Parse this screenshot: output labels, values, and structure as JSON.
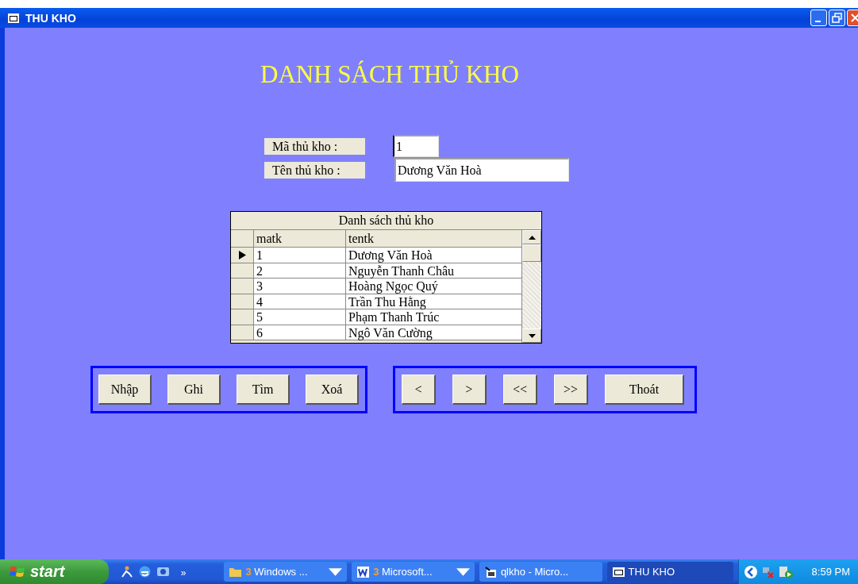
{
  "window": {
    "title": "THU KHO"
  },
  "form": {
    "heading": "DANH SÁCH THỦ KHO",
    "fields": [
      {
        "label": "Mã thủ kho :",
        "value": "1",
        "focused": true
      },
      {
        "label": "Tên thủ kho :",
        "value": "Dương Văn Hoà",
        "focused": false
      }
    ],
    "grid": {
      "caption": "Danh sách thủ kho",
      "columns": [
        "matk",
        "tentk"
      ],
      "rows": [
        {
          "cells": [
            "1",
            "Dương Văn Hoà"
          ],
          "selected": true
        },
        {
          "cells": [
            "2",
            "Nguyễn Thanh Châu"
          ],
          "selected": false
        },
        {
          "cells": [
            "3",
            "Hoàng Ngọc Quý"
          ],
          "selected": false
        },
        {
          "cells": [
            "4",
            "Trần Thu Hằng"
          ],
          "selected": false
        },
        {
          "cells": [
            "5",
            "Phạm Thanh Trúc"
          ],
          "selected": false
        },
        {
          "cells": [
            "6",
            "Ngô Văn Cường"
          ],
          "selected": false
        }
      ]
    },
    "button_groups": [
      [
        "Nhập",
        "Ghi",
        "Tìm",
        "Xoá"
      ],
      [
        "<",
        ">",
        "<<",
        ">>",
        "Thoát"
      ]
    ]
  },
  "taskbar": {
    "start": "start",
    "quick_launch_more": "»",
    "tasks": [
      {
        "kind": "folder",
        "count": "3",
        "label": "Windows ...",
        "grouped": true,
        "active": false
      },
      {
        "kind": "word",
        "count": "3",
        "label": "Microsoft...",
        "grouped": true,
        "active": false
      },
      {
        "kind": "app",
        "label": "qlkho - Micro...",
        "grouped": false,
        "active": false
      },
      {
        "kind": "form",
        "label": "THU KHO",
        "grouped": false,
        "active": true
      }
    ],
    "clock": "8:59 PM"
  }
}
